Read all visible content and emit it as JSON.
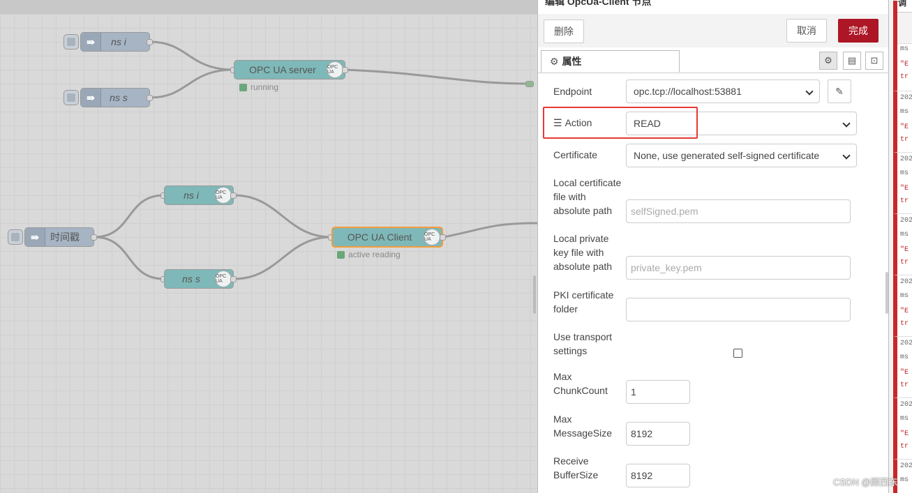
{
  "workspace": {
    "nodes": [
      {
        "id": "ns-i-top",
        "label": "ns i"
      },
      {
        "id": "ns-s-top",
        "label": "ns s"
      },
      {
        "id": "opc-ua-server",
        "label": "OPC UA server",
        "status": "running"
      },
      {
        "id": "ns-i-mid",
        "label": "ns i"
      },
      {
        "id": "timestamp",
        "label": "时间戳"
      },
      {
        "id": "ns-s-mid",
        "label": "ns s"
      },
      {
        "id": "opc-ua-client",
        "label": "OPC UA Client",
        "status": "active reading"
      }
    ],
    "opc_icon_text": "OPC UA"
  },
  "editor": {
    "title": "编辑 OpcUa-Client 节点",
    "delete_label": "删除",
    "cancel_label": "取消",
    "done_label": "完成",
    "tab_label": "属性",
    "fields": {
      "endpoint_label": "Endpoint",
      "endpoint_value": "opc.tcp://localhost:53881",
      "action_label": "Action",
      "action_value": "READ",
      "certificate_label": "Certificate",
      "certificate_value": "None, use generated self-signed certificate",
      "local_cert_label_1": "Local certificate",
      "local_cert_label_2": "file with",
      "local_cert_label_3": "absolute path",
      "local_cert_placeholder": "selfSigned.pem",
      "private_key_label_1": "Local private",
      "private_key_label_2": "key file with",
      "private_key_label_3": "absolute path",
      "private_key_placeholder": "private_key.pem",
      "pki_label_1": "PKI certificate",
      "pki_label_2": "folder",
      "pki_value": "",
      "transport_label_1": "Use transport",
      "transport_label_2": "settings",
      "transport_checked": false,
      "max_chunk_label_1": "Max",
      "max_chunk_label_2": "ChunkCount",
      "max_chunk_value": "1",
      "max_msg_label_1": "Max",
      "max_msg_label_2": "MessageSize",
      "max_msg_value": "8192",
      "recv_buf_label_1": "Receive",
      "recv_buf_label_2": "BufferSize",
      "recv_buf_value": "8192"
    }
  },
  "sidebar": {
    "tab_label": "调",
    "messages": [
      {
        "a": "ms",
        "b": "\"E",
        "c": "tr"
      },
      {
        "a": "202",
        "b": "ms",
        "c": "\"E",
        "d": "tr"
      },
      {
        "a": "202",
        "b": "ms",
        "c": "\"E",
        "d": "tr"
      },
      {
        "a": "202",
        "b": "ms",
        "c": "\"E",
        "d": "tr"
      },
      {
        "a": "202",
        "b": "ms",
        "c": "\"E",
        "d": "tr"
      },
      {
        "a": "202",
        "b": "ms",
        "c": "\"E",
        "d": "tr"
      },
      {
        "a": "202",
        "b": "ms",
        "c": "\"E",
        "d": "tr"
      },
      {
        "a": "202",
        "b": "ms"
      }
    ]
  },
  "watermark": "CSDN @顾西东"
}
